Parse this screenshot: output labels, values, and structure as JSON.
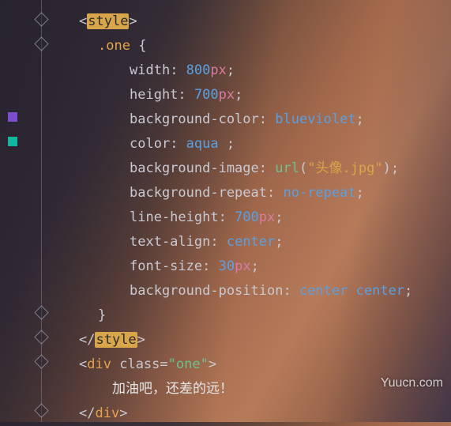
{
  "code": {
    "style_open": {
      "br_open": "<",
      "tag": "style",
      "br_close": ">"
    },
    "sel_open": {
      "selector": ".one",
      "brace": " {"
    },
    "props": {
      "width": {
        "name": "width",
        "colon": ": ",
        "num": "800",
        "unit": "px",
        "semi": ";"
      },
      "height": {
        "name": "height",
        "colon": ": ",
        "num": "700",
        "unit": "px",
        "semi": ";"
      },
      "bgcolor": {
        "name": "background-color",
        "colon": ": ",
        "val": "blueviolet",
        "semi": ";"
      },
      "color": {
        "name": "color",
        "colon": ": ",
        "val": "aqua ",
        "semi": ";"
      },
      "bgimage": {
        "name": "background-image",
        "colon": ": ",
        "func": "url",
        "paren_o": "(",
        "str": "\"头像.jpg\"",
        "paren_c": ")",
        "semi": ";"
      },
      "bgrepeat": {
        "name": "background-repeat",
        "colon": ": ",
        "val": "no-repeat",
        "semi": ";"
      },
      "lh": {
        "name": "line-height",
        "colon": ": ",
        "num": "700",
        "unit": "px",
        "semi": ";"
      },
      "ta": {
        "name": "text-align",
        "colon": ": ",
        "val": "center",
        "semi": ";"
      },
      "fs": {
        "name": "font-size",
        "colon": ": ",
        "num": "30",
        "unit": "px",
        "semi": ";"
      },
      "bgpos": {
        "name": "background-position",
        "colon": ": ",
        "val1": "center",
        "sp": " ",
        "val2": "center",
        "semi": ";"
      }
    },
    "sel_close": "}",
    "style_close": {
      "br_open": "</",
      "tag": "style",
      "br_close": ">"
    },
    "div_open": {
      "br_open": "<",
      "tag": "div",
      "sp": " ",
      "attr": "class",
      "eq": "=",
      "val": "\"one\"",
      "br_close": ">"
    },
    "div_text": "加油吧，还差的远！",
    "div_close": {
      "br_open": "</",
      "tag": "div",
      "br_close": ">"
    }
  },
  "watermark": "Yuucn.com"
}
